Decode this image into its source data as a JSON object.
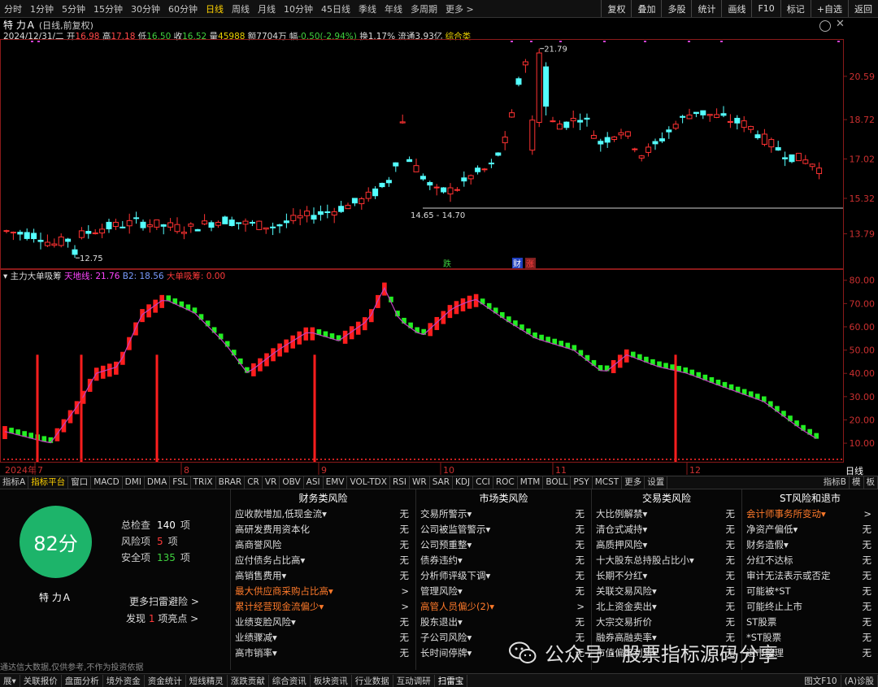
{
  "topbar": {
    "periods": [
      "分时",
      "1分钟",
      "5分钟",
      "15分钟",
      "30分钟",
      "60分钟",
      "日线",
      "周线",
      "月线",
      "10分钟",
      "45日线",
      "季线",
      "年线",
      "多周期",
      "更多 >"
    ],
    "selected_index": 6,
    "tools": [
      "复权",
      "叠加",
      "多股",
      "统计",
      "画线",
      "F10",
      "标记",
      "+自选",
      "返回"
    ]
  },
  "title": {
    "name": "特 力Ａ",
    "sub": "(日线,前复权)"
  },
  "info": {
    "date": "2024/12/31/二",
    "open_label": "开",
    "open": "16.98",
    "high_label": "高",
    "high": "17.18",
    "low_label": "低",
    "low": "16.50",
    "close_label": "收",
    "close": "16.52",
    "vol_label": "量",
    "vol": "45988",
    "amt_label": "额",
    "amt": "7704万",
    "chg_label": "幅",
    "chg": "-0.50(-2.94%)",
    "turn_label": "换",
    "turn": "1.17%",
    "float_label": "流通",
    "float": "3.93亿",
    "sector": "综合类"
  },
  "price_axis": [
    "20.59",
    "18.72",
    "17.02",
    "15.32",
    "13.79"
  ],
  "price_annotations": {
    "high": "21.79",
    "low": "12.75",
    "range": "14.65 - 14.70"
  },
  "event_tags": [
    "跌",
    "财",
    "涨"
  ],
  "indicator": {
    "name": "主力大单吸筹",
    "l1": "天地线: 21.76",
    "l2": "B2: 18.56",
    "l3": "大单吸筹: 0.00"
  },
  "indicator_axis": [
    "80.00",
    "70.00",
    "60.00",
    "50.00",
    "40.00",
    "30.00",
    "20.00",
    "10.00"
  ],
  "x_axis": {
    "year": "2024年",
    "months": [
      "7",
      "8",
      "9",
      "10",
      "11",
      "12"
    ],
    "period_label": "日线"
  },
  "tabbar": {
    "items": [
      "指标A",
      "指标平台",
      "窗口",
      "MACD",
      "DMI",
      "DMA",
      "FSL",
      "TRIX",
      "BRAR",
      "CR",
      "VR",
      "OBV",
      "ASI",
      "EMV",
      "VOL-TDX",
      "RSI",
      "WR",
      "SAR",
      "KDJ",
      "CCI",
      "ROC",
      "MTM",
      "BOLL",
      "PSY",
      "MCST",
      "更多",
      "设置"
    ],
    "selected_index": 1,
    "right": [
      "指标B",
      "模",
      "板"
    ]
  },
  "panel": {
    "score": "82分",
    "stock": "特 力Ａ",
    "stats": [
      {
        "label": "总检查",
        "value": "140",
        "unit": "项",
        "color": "w"
      },
      {
        "label": "风险项",
        "value": "5",
        "unit": "项",
        "color": "r"
      },
      {
        "label": "安全项",
        "value": "135",
        "unit": "项",
        "color": "g"
      }
    ],
    "more": "更多扫雷避险 >",
    "found_pre": "发现",
    "found_num": "1",
    "found_post": "项亮点 >",
    "disclaimer": "通达信大数据,仅供参考,不作为投资依据",
    "columns": [
      {
        "title": "财务类风险",
        "items": [
          {
            "label": "应收款增加,低现金流▾",
            "value": "无",
            "hl": false
          },
          {
            "label": "高研发费用资本化",
            "value": "无",
            "hl": false
          },
          {
            "label": "高商誉风险",
            "value": "无",
            "hl": false
          },
          {
            "label": "应付债务占比高▾",
            "value": "无",
            "hl": false
          },
          {
            "label": "高销售费用▾",
            "value": "无",
            "hl": false
          },
          {
            "label": "最大供应商采购占比高▾",
            "value": ">",
            "hl": true
          },
          {
            "label": "累计经营现金流偏少▾",
            "value": ">",
            "hl": true
          },
          {
            "label": "业绩变脸风险▾",
            "value": "无",
            "hl": false
          },
          {
            "label": "业绩骤减▾",
            "value": "无",
            "hl": false
          },
          {
            "label": "高市销率▾",
            "value": "无",
            "hl": false
          }
        ]
      },
      {
        "title": "市场类风险",
        "items": [
          {
            "label": "交易所警示▾",
            "value": "无",
            "hl": false
          },
          {
            "label": "公司被监管警示▾",
            "value": "无",
            "hl": false
          },
          {
            "label": "公司预重整▾",
            "value": "无",
            "hl": false
          },
          {
            "label": "债券违约▾",
            "value": "无",
            "hl": false
          },
          {
            "label": "分析师评级下调▾",
            "value": "无",
            "hl": false
          },
          {
            "label": "管理风险▾",
            "value": "无",
            "hl": false
          },
          {
            "label": "高管人员偏少(2)▾",
            "value": ">",
            "hl": true
          },
          {
            "label": "股东退出▾",
            "value": "无",
            "hl": false
          },
          {
            "label": "子公司风险▾",
            "value": "无",
            "hl": false
          },
          {
            "label": "长时间停牌▾",
            "value": "无",
            "hl": false
          }
        ]
      },
      {
        "title": "交易类风险",
        "items": [
          {
            "label": "大比例解禁▾",
            "value": "无",
            "hl": false
          },
          {
            "label": "清仓式减持▾",
            "value": "无",
            "hl": false
          },
          {
            "label": "高质押风险▾",
            "value": "无",
            "hl": false
          },
          {
            "label": "十大股东总持股占比小▾",
            "value": "无",
            "hl": false
          },
          {
            "label": "长期不分红▾",
            "value": "无",
            "hl": false
          },
          {
            "label": "关联交易风险▾",
            "value": "无",
            "hl": false
          },
          {
            "label": "北上资金卖出▾",
            "value": "无",
            "hl": false
          },
          {
            "label": "大宗交易折价",
            "value": "无",
            "hl": false
          },
          {
            "label": "融券高融卖率▾",
            "value": "无",
            "hl": false
          },
          {
            "label": "市值偏离利润▾",
            "value": "无",
            "hl": false
          }
        ]
      },
      {
        "title": "ST风险和退市",
        "items": [
          {
            "label": "会计师事务所变动▾",
            "value": ">",
            "hl": true
          },
          {
            "label": "净资产偏低▾",
            "value": "无",
            "hl": false
          },
          {
            "label": "财务造假▾",
            "value": "无",
            "hl": false
          },
          {
            "label": "分红不达标",
            "value": "无",
            "hl": false
          },
          {
            "label": "审计无法表示或否定",
            "value": "无",
            "hl": false
          },
          {
            "label": "可能被*ST",
            "value": "无",
            "hl": false
          },
          {
            "label": "可能终止上市",
            "value": "无",
            "hl": false
          },
          {
            "label": "ST股票",
            "value": "无",
            "hl": false
          },
          {
            "label": "*ST股票",
            "value": "无",
            "hl": false
          },
          {
            "label": "退市整理",
            "value": "无",
            "hl": false
          }
        ]
      }
    ]
  },
  "watermark": "公众号 · 股票指标源码分享",
  "bottombar": {
    "items": [
      "展▾",
      "关联报价",
      "盘面分析",
      "境外资金",
      "资金统计",
      "短线精灵",
      "涨跌贡献",
      "综合资讯",
      "板块资讯",
      "行业数据",
      "互动调研",
      "扫雷宝"
    ],
    "selected_index": 11,
    "right": [
      "图文F10",
      "(A)诊股"
    ]
  }
}
